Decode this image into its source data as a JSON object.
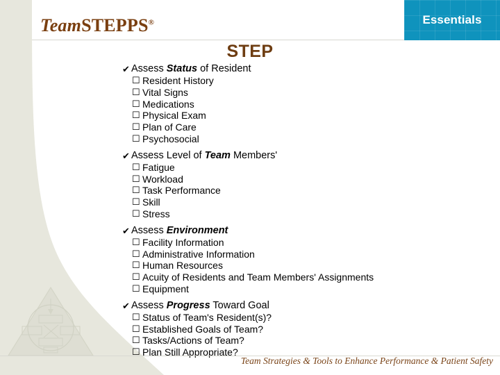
{
  "brand": {
    "team": "Team",
    "stepps": "STEPPS",
    "registered": "®"
  },
  "banner": {
    "label": "Essentials",
    "color": "#0F93BD"
  },
  "title": "STEP",
  "colors": {
    "title_brown": "#6E3D12",
    "brand_brown": "#7A3F10",
    "cream": "#E6E6DC",
    "accent_teal": "#0F93BD"
  },
  "icons": {
    "check": "✔",
    "checkbox": "☐"
  },
  "groups": [
    {
      "head_prefix": "Assess ",
      "head_bold": "Status",
      "head_suffix": " of Resident",
      "items": [
        "Resident History",
        "Vital Signs",
        "Medications",
        "Physical Exam",
        "Plan of Care",
        "Psychosocial"
      ]
    },
    {
      "head_prefix": "Assess Level of ",
      "head_bold": "Team",
      "head_suffix": " Members'",
      "items": [
        "Fatigue",
        "Workload",
        "Task Performance",
        "Skill",
        "Stress"
      ]
    },
    {
      "head_prefix": "Assess ",
      "head_bold": "Environment",
      "head_suffix": "",
      "items": [
        "Facility Information",
        "Administrative Information",
        "Human Resources",
        "Acuity of Residents and Team Members' Assignments",
        "Equipment"
      ]
    },
    {
      "head_prefix": "Assess ",
      "head_bold": "Progress",
      "head_suffix": " Toward Goal",
      "items": [
        "Status of Team's Resident(s)?",
        "Established Goals of Team?",
        "Tasks/Actions of Team?",
        "Plan Still Appropriate?"
      ]
    }
  ],
  "footer": {
    "tagline": "Team Strategies & Tools to Enhance Performance & Patient Safety"
  }
}
